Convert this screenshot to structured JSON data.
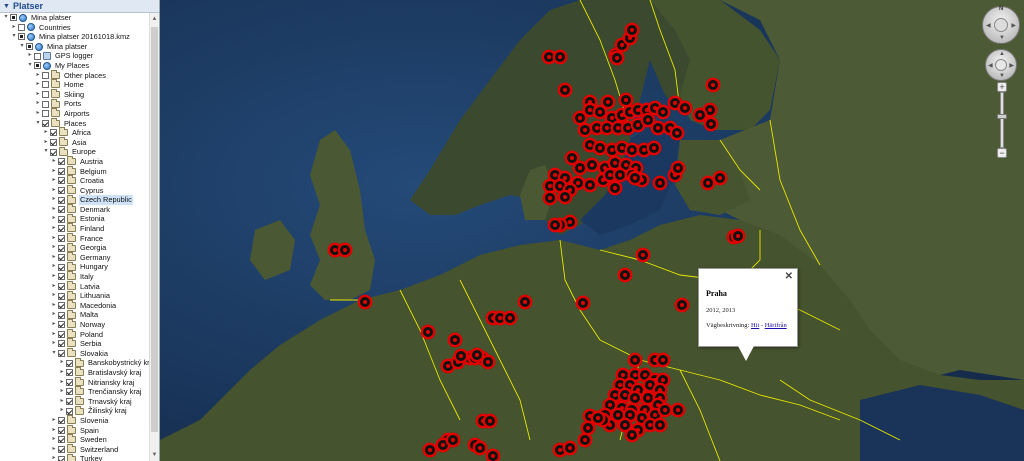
{
  "panel": {
    "header": "Platser",
    "tree": [
      {
        "depth": 0,
        "expand": "-",
        "check": "partial",
        "icon": "globe",
        "label": "Mina platser"
      },
      {
        "depth": 1,
        "expand": "+",
        "check": "none",
        "icon": "globe",
        "label": "Countries"
      },
      {
        "depth": 1,
        "expand": "-",
        "check": "partial",
        "icon": "globe",
        "label": "Mina platser 20161018.kmz"
      },
      {
        "depth": 2,
        "expand": "-",
        "check": "partial",
        "icon": "globe",
        "label": "Mina platser"
      },
      {
        "depth": 3,
        "expand": "+",
        "check": "none",
        "icon": "gps",
        "label": "GPS logger"
      },
      {
        "depth": 3,
        "expand": "-",
        "check": "partial",
        "icon": "globe",
        "label": "My Places"
      },
      {
        "depth": 4,
        "expand": "+",
        "check": "none",
        "icon": "folder",
        "label": "Other places"
      },
      {
        "depth": 4,
        "expand": "+",
        "check": "none",
        "icon": "folder",
        "label": "Home"
      },
      {
        "depth": 4,
        "expand": "+",
        "check": "none",
        "icon": "folder",
        "label": "Skiing"
      },
      {
        "depth": 4,
        "expand": "+",
        "check": "none",
        "icon": "folder",
        "label": "Ports"
      },
      {
        "depth": 4,
        "expand": "+",
        "check": "none",
        "icon": "folder",
        "label": "Airports"
      },
      {
        "depth": 4,
        "expand": "-",
        "check": "checked",
        "icon": "folder",
        "label": "Places"
      },
      {
        "depth": 5,
        "expand": "+",
        "check": "checked",
        "icon": "folder",
        "label": "Africa"
      },
      {
        "depth": 5,
        "expand": "+",
        "check": "checked",
        "icon": "folder",
        "label": "Asia"
      },
      {
        "depth": 5,
        "expand": "-",
        "check": "checked",
        "icon": "folder",
        "label": "Europe"
      },
      {
        "depth": 6,
        "expand": "+",
        "check": "checked",
        "icon": "folder",
        "label": "Austria"
      },
      {
        "depth": 6,
        "expand": "+",
        "check": "checked",
        "icon": "folder",
        "label": "Belgium"
      },
      {
        "depth": 6,
        "expand": "+",
        "check": "checked",
        "icon": "folder",
        "label": "Croatia"
      },
      {
        "depth": 6,
        "expand": "+",
        "check": "checked",
        "icon": "folder",
        "label": "Cyprus"
      },
      {
        "depth": 6,
        "expand": "+",
        "check": "checked",
        "icon": "folder",
        "label": "Czech Republic",
        "selected": true
      },
      {
        "depth": 6,
        "expand": "+",
        "check": "checked",
        "icon": "folder",
        "label": "Denmark"
      },
      {
        "depth": 6,
        "expand": "+",
        "check": "checked",
        "icon": "folder",
        "label": "Estonia"
      },
      {
        "depth": 6,
        "expand": "+",
        "check": "checked",
        "icon": "folder",
        "label": "Finland"
      },
      {
        "depth": 6,
        "expand": "+",
        "check": "checked",
        "icon": "folder",
        "label": "France"
      },
      {
        "depth": 6,
        "expand": "+",
        "check": "checked",
        "icon": "folder",
        "label": "Georgia"
      },
      {
        "depth": 6,
        "expand": "+",
        "check": "checked",
        "icon": "folder",
        "label": "Germany"
      },
      {
        "depth": 6,
        "expand": "+",
        "check": "checked",
        "icon": "folder",
        "label": "Hungary"
      },
      {
        "depth": 6,
        "expand": "+",
        "check": "checked",
        "icon": "folder",
        "label": "Italy"
      },
      {
        "depth": 6,
        "expand": "+",
        "check": "checked",
        "icon": "folder",
        "label": "Latvia"
      },
      {
        "depth": 6,
        "expand": "+",
        "check": "checked",
        "icon": "folder",
        "label": "Lithuania"
      },
      {
        "depth": 6,
        "expand": "+",
        "check": "checked",
        "icon": "folder",
        "label": "Macedonia"
      },
      {
        "depth": 6,
        "expand": "+",
        "check": "checked",
        "icon": "folder",
        "label": "Malta"
      },
      {
        "depth": 6,
        "expand": "+",
        "check": "checked",
        "icon": "folder",
        "label": "Norway"
      },
      {
        "depth": 6,
        "expand": "+",
        "check": "checked",
        "icon": "folder",
        "label": "Poland"
      },
      {
        "depth": 6,
        "expand": "+",
        "check": "checked",
        "icon": "folder",
        "label": "Serbia"
      },
      {
        "depth": 6,
        "expand": "-",
        "check": "checked",
        "icon": "folder",
        "label": "Slovakia"
      },
      {
        "depth": 7,
        "expand": "+",
        "check": "checked",
        "icon": "folder",
        "label": "Banskobystrický kraj"
      },
      {
        "depth": 7,
        "expand": "+",
        "check": "checked",
        "icon": "folder",
        "label": "Bratislavský kraj"
      },
      {
        "depth": 7,
        "expand": "+",
        "check": "checked",
        "icon": "folder",
        "label": "Nitriansky kraj"
      },
      {
        "depth": 7,
        "expand": "+",
        "check": "checked",
        "icon": "folder",
        "label": "Trenčiansky kraj"
      },
      {
        "depth": 7,
        "expand": "+",
        "check": "checked",
        "icon": "folder",
        "label": "Trnavský kraj"
      },
      {
        "depth": 7,
        "expand": "+",
        "check": "checked",
        "icon": "folder",
        "label": "Žilinský kraj"
      },
      {
        "depth": 6,
        "expand": "+",
        "check": "checked",
        "icon": "folder",
        "label": "Slovenia"
      },
      {
        "depth": 6,
        "expand": "+",
        "check": "checked",
        "icon": "folder",
        "label": "Spain"
      },
      {
        "depth": 6,
        "expand": "+",
        "check": "checked",
        "icon": "folder",
        "label": "Sweden"
      },
      {
        "depth": 6,
        "expand": "+",
        "check": "checked",
        "icon": "folder",
        "label": "Switzerland"
      },
      {
        "depth": 6,
        "expand": "+",
        "check": "checked",
        "icon": "folder",
        "label": "Turkey"
      }
    ]
  },
  "balloon": {
    "title": "Praha",
    "years": "2012, 2013",
    "directions_prefix": "Vägbeskrivning: ",
    "link_to": "Hit",
    "separator": " - ",
    "link_from": "Härifrån",
    "close": "✕"
  },
  "nav": {
    "compass_letter": "N",
    "zoom_in": "+",
    "zoom_out": "−"
  },
  "colors": {
    "placemark_ring": "#e00000",
    "border": "#e8e800",
    "sea": "#1d3a63",
    "land": "#3d4b2a"
  }
}
